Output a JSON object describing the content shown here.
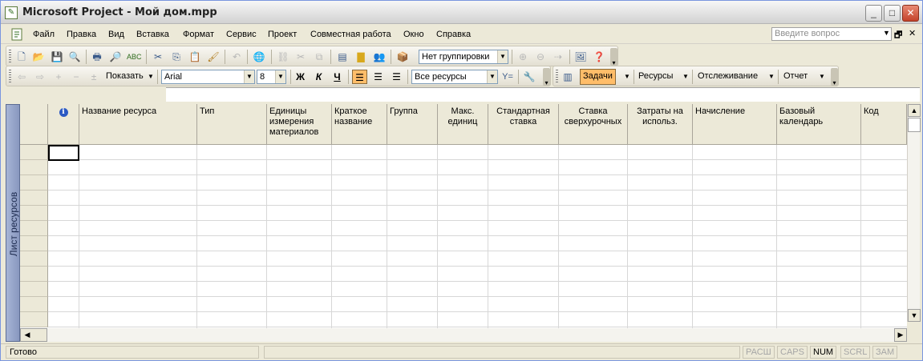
{
  "window": {
    "title": "Microsoft Project - Мой дом.mpp",
    "controls": {
      "minimize": "_",
      "maximize": "□",
      "close": "✕"
    }
  },
  "menu": {
    "items": [
      "Файл",
      "Правка",
      "Вид",
      "Вставка",
      "Формат",
      "Сервис",
      "Проект",
      "Совместная работа",
      "Окно",
      "Справка"
    ],
    "help_placeholder": "Введите вопрос"
  },
  "toolbar_standard": {
    "grouping_value": "Нет группировки"
  },
  "toolbar_formatting": {
    "show_label": "Показать",
    "font_name": "Arial",
    "font_size": "8",
    "bold": "Ж",
    "italic": "К",
    "underline": "Ч",
    "filter_value": "Все ресурсы"
  },
  "guide_bar": {
    "tasks": "Задачи",
    "resources": "Ресурсы",
    "tracking": "Отслеживание",
    "report": "Отчет"
  },
  "view_bar": {
    "label": "Лист ресурсов"
  },
  "grid": {
    "columns": [
      {
        "key": "indicator",
        "label": ""
      },
      {
        "key": "name",
        "label": "Название ресурса"
      },
      {
        "key": "type",
        "label": "Тип"
      },
      {
        "key": "material_units",
        "label": "Единицы измерения материалов"
      },
      {
        "key": "initials",
        "label": "Краткое название"
      },
      {
        "key": "group",
        "label": "Группа"
      },
      {
        "key": "max_units",
        "label": "Макс. единиц"
      },
      {
        "key": "std_rate",
        "label": "Стандартная ставка"
      },
      {
        "key": "ovt_rate",
        "label": "Ставка сверхурочных"
      },
      {
        "key": "cost_use",
        "label": "Затраты на использ."
      },
      {
        "key": "accrue",
        "label": "Начисление"
      },
      {
        "key": "base_cal",
        "label": "Базовый календарь"
      },
      {
        "key": "code",
        "label": "Код"
      }
    ],
    "rows": []
  },
  "status": {
    "text": "Готово",
    "indicators": [
      "РАСШ",
      "CAPS",
      "NUM",
      "SCRL",
      "ЗАМ"
    ],
    "active_indicator": "NUM"
  }
}
